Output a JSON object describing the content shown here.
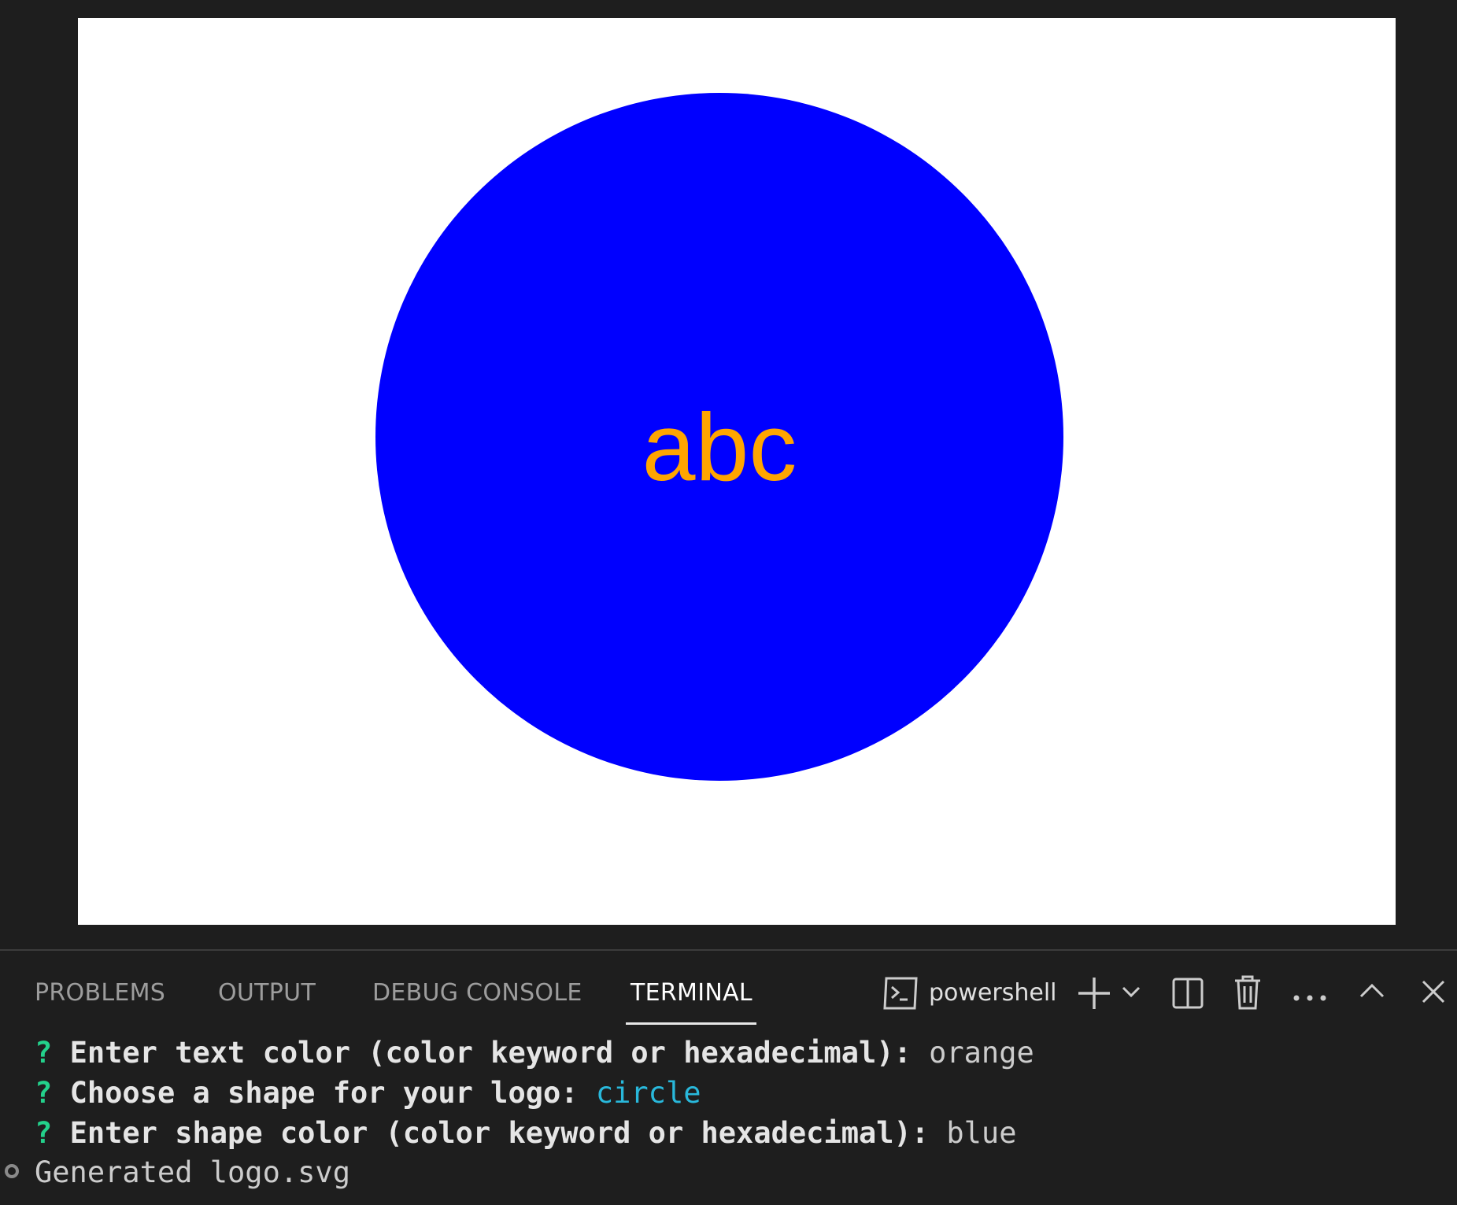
{
  "preview": {
    "logo_text": "abc",
    "text_color": "#ffa500",
    "shape": "circle",
    "shape_color": "#0000ff",
    "background_color": "#ffffff"
  },
  "panel": {
    "tabs": [
      {
        "label": "PROBLEMS",
        "active": false
      },
      {
        "label": "OUTPUT",
        "active": false
      },
      {
        "label": "DEBUG CONSOLE",
        "active": false
      },
      {
        "label": "TERMINAL",
        "active": true
      }
    ],
    "shell": {
      "icon": "terminal-icon",
      "name": "powershell"
    },
    "actions": {
      "new_terminal_icon": "plus-icon",
      "launch_profile_icon": "chevron-down-icon",
      "split_icon": "split-editor-icon",
      "kill_icon": "trash-icon",
      "more_icon": "ellipsis-icon",
      "maximize_icon": "chevron-up-icon",
      "close_icon": "close-icon"
    }
  },
  "terminal": {
    "lines": [
      {
        "mark": "?",
        "prompt": "Enter text color (color keyword or hexadecimal):",
        "answer": "orange"
      },
      {
        "mark": "?",
        "prompt": "Choose a shape for your logo:",
        "answer": "circle"
      },
      {
        "mark": "?",
        "prompt": "Enter shape color (color keyword or hexadecimal):",
        "answer": "blue"
      }
    ],
    "output": "Generated logo.svg"
  },
  "colors": {
    "background": "#1e1e1e",
    "question_mark": "#23d18b",
    "selected_answer": "#29b8db"
  }
}
